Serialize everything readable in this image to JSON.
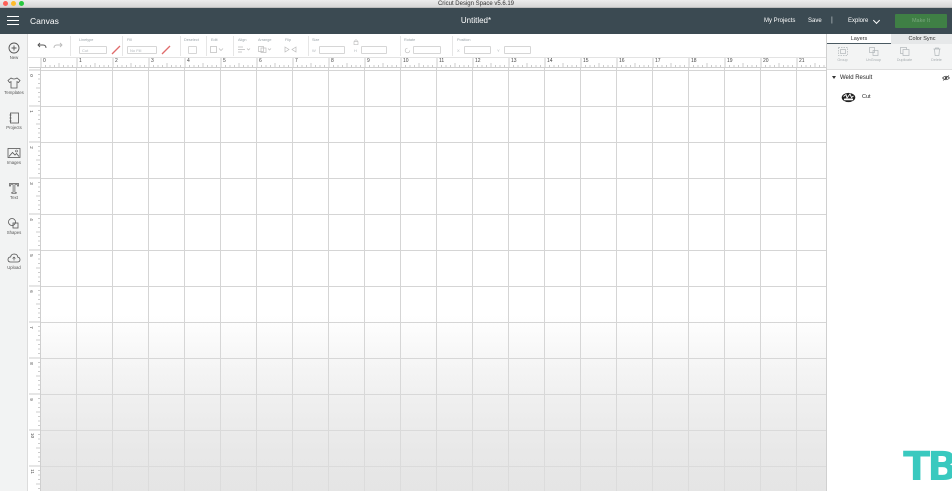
{
  "window": {
    "title": "Cricut Design Space  v5.6.19"
  },
  "header": {
    "section_label": "Canvas",
    "document_title": "Untitled*",
    "my_projects": "My Projects",
    "save": "Save",
    "separator": "|",
    "explore": "Explore",
    "make_it": "Make It",
    "colors": {
      "header_bg": "#3b4a52",
      "make_it_bg": "#3f7f45"
    }
  },
  "sidebar": {
    "items": [
      {
        "label": "New",
        "icon": "plus-circle-icon"
      },
      {
        "label": "Templates",
        "icon": "shirt-icon"
      },
      {
        "label": "Projects",
        "icon": "projects-icon"
      },
      {
        "label": "Images",
        "icon": "image-icon"
      },
      {
        "label": "Text",
        "icon": "text-t-icon"
      },
      {
        "label": "Shapes",
        "icon": "shapes-icon"
      },
      {
        "label": "Upload",
        "icon": "upload-cloud-icon"
      }
    ]
  },
  "toolbar": {
    "linetype_label": "Linetype",
    "linetype_value": "Cut",
    "fill_label": "Fill",
    "fill_value": "No Fill",
    "deselect_label": "Deselect",
    "edit_label": "Edit",
    "align_label": "Align",
    "arrange_label": "Arrange",
    "flip_label": "Flip",
    "size_label": "Size",
    "size_w": "W",
    "size_h": "H",
    "rotate_label": "Rotate",
    "position_label": "Position",
    "position_x": "X",
    "position_y": "Y"
  },
  "rulers": {
    "horizontal": [
      "0",
      "1",
      "2",
      "3",
      "4",
      "5",
      "6",
      "7",
      "8",
      "9",
      "10",
      "11",
      "12",
      "13",
      "14",
      "15",
      "16",
      "17",
      "18",
      "19",
      "20",
      "21"
    ],
    "vertical": [
      "0",
      "1",
      "2",
      "3",
      "4",
      "5",
      "6",
      "7",
      "8",
      "9",
      "10",
      "11"
    ]
  },
  "layers_panel": {
    "tabs": [
      {
        "label": "Layers",
        "active": true
      },
      {
        "label": "Color Sync",
        "active": false
      }
    ],
    "actions": [
      {
        "label": "Group",
        "icon": "group-icon"
      },
      {
        "label": "UnGroup",
        "icon": "ungroup-icon"
      },
      {
        "label": "Duplicate",
        "icon": "duplicate-icon"
      },
      {
        "label": "Delete",
        "icon": "delete-icon"
      }
    ],
    "group": {
      "title": "Weld Result",
      "icon": "visibility-icon"
    },
    "layer": {
      "label": "Cut"
    }
  },
  "watermark": {
    "text": "TB",
    "color": "#39c9bf"
  }
}
